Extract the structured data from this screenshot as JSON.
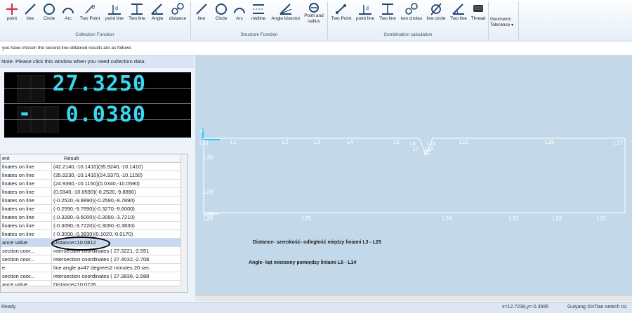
{
  "ribbon": {
    "collection_tools": [
      {
        "label": "point",
        "icon": "point-icon"
      },
      {
        "label": "line",
        "icon": "line-icon"
      },
      {
        "label": "Circle",
        "icon": "circle-icon"
      },
      {
        "label": "Arc",
        "icon": "arc-icon"
      },
      {
        "label": "Two Point",
        "icon": "two-point-icon"
      },
      {
        "label": "point line",
        "icon": "point-line-icon"
      },
      {
        "label": "Two line",
        "icon": "two-line-icon"
      },
      {
        "label": "Angle",
        "icon": "angle-icon"
      },
      {
        "label": "distance",
        "icon": "distance-icon"
      }
    ],
    "collection_group": "Collection Function",
    "structure_tools": [
      {
        "label": "line",
        "icon": "line-icon"
      },
      {
        "label": "Circle",
        "icon": "circle-icon"
      },
      {
        "label": "Arc",
        "icon": "arc-icon"
      },
      {
        "label": "midline",
        "icon": "midline-icon"
      },
      {
        "label": "Angle bisector",
        "icon": "angle-bisector-icon"
      },
      {
        "label": "Point and",
        "label2": "radius",
        "icon": "point-radius-icon"
      }
    ],
    "structure_group": "Structure Function",
    "combination_tools": [
      {
        "label": "Two Point",
        "icon": "two-point-icon"
      },
      {
        "label": "point line",
        "icon": "point-line-icon"
      },
      {
        "label": "Two line",
        "icon": "two-line-icon"
      },
      {
        "label": "two circles",
        "icon": "two-circles-icon"
      },
      {
        "label": "line circle",
        "icon": "line-circle-icon"
      },
      {
        "label": "Two line",
        "icon": "two-line-angle-icon"
      },
      {
        "label": "Thread",
        "icon": "thread-icon"
      }
    ],
    "combination_group": "Combination calculation",
    "geometric_tolerance": {
      "line1": "Geometric",
      "line2": "Tolerance"
    }
  },
  "message": "you have chosen the second line obtained results are as follows",
  "note": "Note: Please click this window when you need collection data.",
  "dro": {
    "value1": "27.3250",
    "value2": "0.0380",
    "sign2": "-"
  },
  "table": {
    "headers": [
      "ent",
      "Result"
    ],
    "rows": [
      [
        "linates on line",
        "(42.2140,-10.1410)(35.9240,-10.1410)"
      ],
      [
        "linates on line",
        "(35.9230,-10.1410)(24.9370,-10.1150)"
      ],
      [
        "linates on line",
        "(24.9360,-10.1150)(0.0340,-10.0590)"
      ],
      [
        "linates on line",
        "(0.0340,-10.0590)(-0.2520,-9.8890)"
      ],
      [
        "linates on line",
        "(-0.2520,-9.8890)(-0.2590,-9.7890)"
      ],
      [
        "linates on line",
        "(-0.2590,-9.7890)(-0.3270,-9.6000)"
      ],
      [
        "linates on line",
        "(-0.3280,-9.6000)(-0.3090,-3.7210)"
      ],
      [
        "linates on line",
        "(-0.3090,-3.7220)(-0.3090,-0.3830)"
      ],
      [
        "linates on line",
        "(-0.3090,-0.3830)(0.1020,-0.0170)"
      ],
      [
        "ance value",
        "Distance=10.0812"
      ],
      [
        "section coor...",
        "intersection coordinates ( 27.3221,-2.551"
      ],
      [
        "section coor...",
        "intersection coordinates ( 27.4032,-2.708"
      ],
      [
        "e",
        "line angle a=47 degrees2 minutes 20 sec"
      ],
      [
        "section coor...",
        "intersection coordinates ( 27.3836,-2.688"
      ],
      [
        "ance value",
        "Distance=10.0726"
      ]
    ]
  },
  "canvas": {
    "axis_label": "Y",
    "line_labels_top": [
      "L31",
      "L1",
      "L2",
      "L3",
      "L4",
      "L5",
      "L6",
      "L14",
      "L7",
      "L13",
      "L15",
      "L16",
      "L17"
    ],
    "line_labels_bottom": [
      "L26",
      "L25",
      "L24",
      "L23",
      "L22",
      "L21"
    ],
    "line_labels_left": [
      "L30",
      "L29",
      "L28"
    ],
    "annotation1": "Distance- szerokość- odległość między liniami  L3 - L25",
    "annotation2": "Angle- kąt mierzony pomiędzy liniami   L6 - L14"
  },
  "status": {
    "left": "Ready",
    "coords": "x=12.7238,y=-0.3595",
    "company": "Guiyang XinTian oetech co."
  }
}
